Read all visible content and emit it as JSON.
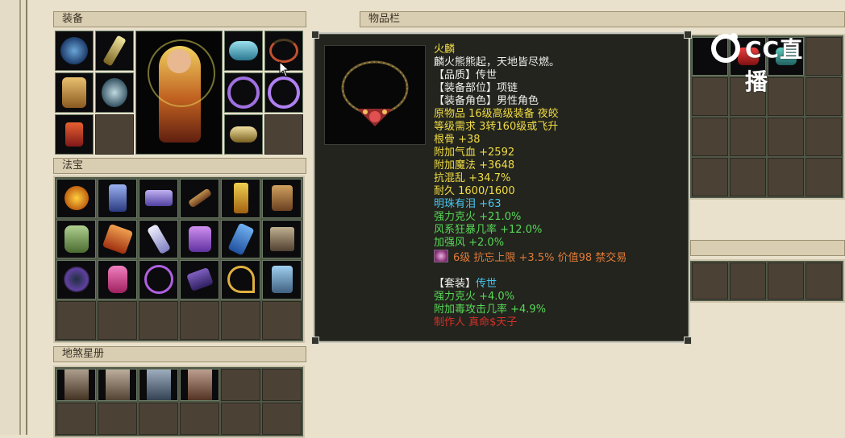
{
  "panels": {
    "equipment": "装备",
    "treasure": "法宝",
    "star_book": "地煞星册",
    "inventory": "物品栏"
  },
  "tooltip": {
    "name": "火麟",
    "desc": "麟火熊熊起，天地皆尽燃。",
    "quality": "【品质】传世",
    "slot": "【装备部位】项链",
    "role": "【装备角色】男性角色",
    "source": "原物品 16级高级装备 夜皎",
    "level_req": "等级需求 3转160级或飞升",
    "stat_gengu": "根骨 +38",
    "stat_hp": "附加气血 +2592",
    "stat_mp": "附加魔法 +3648",
    "stat_anti_chaos": "抗混乱 +34.7%",
    "durability": "耐久 1600/1600",
    "pearl": "明珠有泪 +63",
    "strong_fire": "强力克火 +21.0%",
    "wind_crit": "风系狂暴几率 +12.0%",
    "strong_wind": "加强风 +2.0%",
    "gem_line": "6级 抗忘上限 +3.5% 价值98 禁交易",
    "set_label": "【套装】",
    "set_value": "传世",
    "set_fire": "强力克火 +4.0%",
    "set_poison": "附加毒攻击几率 +4.9%",
    "maker": "制作人 真命$天子"
  },
  "watermark": {
    "text": "CC直播",
    "icon": "cc-logo-icon"
  },
  "colors": {
    "item_name": "#f2dc45",
    "attr_cyan": "#49c6f0",
    "attr_green": "#58d858",
    "attr_orange": "#e07a3a",
    "maker_red": "#d8302a"
  }
}
